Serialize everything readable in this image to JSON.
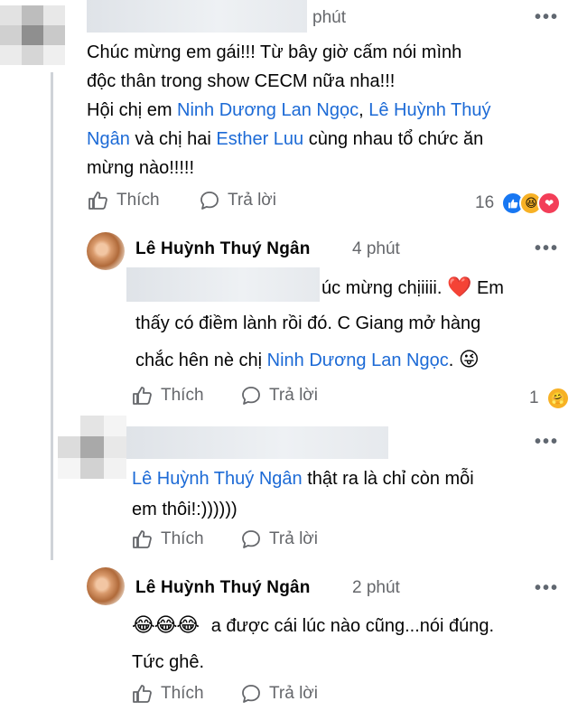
{
  "comments": [
    {
      "id": "c1",
      "time": "phút",
      "lines": [
        [
          {
            "t": "Chúc mừng em gái!!! Từ bây giờ cấm nói mình"
          }
        ],
        [
          {
            "t": "độc thân trong show CECM nữa nha!!!"
          }
        ],
        [
          {
            "t": "Hội chị em "
          },
          {
            "t": "Ninh Dương Lan Ngọc",
            "m": true
          },
          {
            "t": ", "
          },
          {
            "t": "Lê Huỳnh Thuý",
            "m": true
          }
        ],
        [
          {
            "t": "Ngân",
            "m": true
          },
          {
            "t": " và chị hai "
          },
          {
            "t": "Esther Luu",
            "m": true
          },
          {
            "t": " cùng nhau tổ chức ăn"
          }
        ],
        [
          {
            "t": "mừng nào!!!!!"
          }
        ]
      ],
      "like_label": "Thích",
      "reply_label": "Trả lời",
      "reaction_count": "16"
    },
    {
      "id": "c2",
      "author": "Lê Huỳnh Thuý Ngân",
      "time": "4 phút",
      "line1_visible": "úc mừng chịiiii.",
      "line1_tail": "Em",
      "line2": "thấy có điềm lành rồi đó. C Giang mở hàng",
      "line3_pre": "chắc hên nè chị ",
      "line3_mention": "Ninh Dương Lan Ngọc",
      "line3_post": ".",
      "like_label": "Thích",
      "reply_label": "Trả lời",
      "reaction_count": "1"
    },
    {
      "id": "c3",
      "mention": "Lê Huỳnh Thuý Ngân",
      "line1_post": " thật ra là chỉ còn mỗi",
      "line2": "em thôi!:))))))",
      "like_label": "Thích",
      "reply_label": "Trả lời"
    },
    {
      "id": "c4",
      "author": "Lê Huỳnh Thuý Ngân",
      "time": "2 phút",
      "emoji": "😂😂😂",
      "line1": "a được cái lúc nào cũng...nói đúng.",
      "line2": "Tức ghê.",
      "like_label": "Thích",
      "reply_label": "Trả lời"
    }
  ],
  "icons": {
    "more": "more-options-icon",
    "like": "thumbs-up-icon",
    "reply": "speech-bubble-icon"
  },
  "colors": {
    "mention": "#1c6ad6",
    "meta": "#65676b",
    "like_blue": "#1877f2",
    "love_red": "#f33e58",
    "haha_yellow": "#f7b125"
  }
}
